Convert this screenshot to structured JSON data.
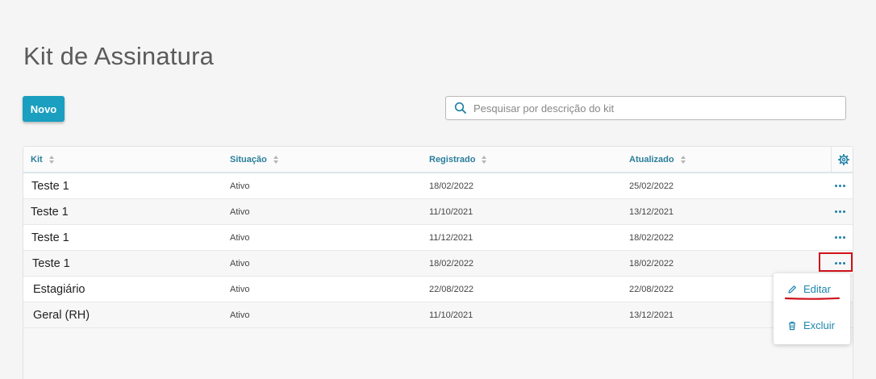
{
  "page": {
    "title": "Kit de Assinatura"
  },
  "toolbar": {
    "new_label": "Novo"
  },
  "search": {
    "placeholder": "Pesquisar por descrição do kit",
    "value": ""
  },
  "table": {
    "columns": [
      "Kit",
      "Situação",
      "Registrado",
      "Atualizado"
    ],
    "rows": [
      {
        "kit": "Teste 1",
        "situacao": "Ativo",
        "registrado": "18/02/2022",
        "atualizado": "25/02/2022"
      },
      {
        "kit": "Teste 1",
        "situacao": "Ativo",
        "registrado": "11/10/2021",
        "atualizado": "13/12/2021"
      },
      {
        "kit": "Teste 1",
        "situacao": "Ativo",
        "registrado": "11/12/2021",
        "atualizado": "18/02/2022"
      },
      {
        "kit": "Teste 1",
        "situacao": "Ativo",
        "registrado": "18/02/2022",
        "atualizado": "18/02/2022"
      },
      {
        "kit": "Estagiário",
        "situacao": "Ativo",
        "registrado": "22/08/2022",
        "atualizado": "22/08/2022"
      },
      {
        "kit": "Geral (RH)",
        "situacao": "Ativo",
        "registrado": "11/10/2021",
        "atualizado": "13/12/2021"
      }
    ]
  },
  "context_menu": {
    "edit_label": "Editar",
    "delete_label": "Excluir"
  },
  "colors": {
    "accent": "#1a9fc0",
    "header_text": "#2a7e9c",
    "annotation": "#d0121b"
  },
  "icons": {
    "search": "search-icon",
    "settings": "gear-icon",
    "more": "more-options-icon",
    "edit": "pencil-icon",
    "delete": "trash-icon"
  }
}
